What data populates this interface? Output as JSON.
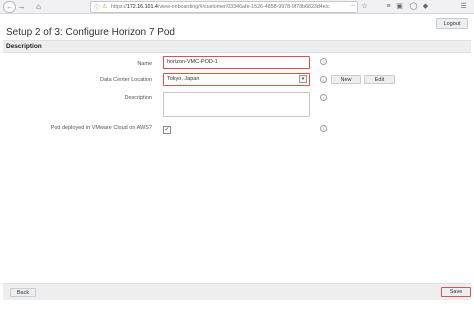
{
  "browser": {
    "url_prefix": "https://",
    "url_host": "172.16.101.4",
    "url_path": "/view-onboarding/#/customer/03346afe-1526-4858-9978-9f78b6823d4e/c",
    "url_overflow": "..."
  },
  "header": {
    "logout_label": "Logout",
    "page_title": "Setup 2 of 3: Configure Horizon 7 Pod"
  },
  "section": {
    "title": "Description"
  },
  "form": {
    "name_label": "Name",
    "name_value": "horizon-VMC-POD-1",
    "datacenter_label": "Data Center Location",
    "datacenter_value": "Tokyo, Japan",
    "new_label": "New",
    "edit_label": "Edit",
    "description_label": "Description",
    "description_value": "",
    "aws_label": "Pod deployed in VMware Cloud on AWS?",
    "aws_checked": true
  },
  "footer": {
    "back_label": "Back",
    "save_label": "Save"
  },
  "colors": {
    "highlight": "#d9534f",
    "section_bg": "#eceef0"
  },
  "icons": [
    "back-arrow-icon",
    "forward-arrow-icon",
    "home-icon",
    "info-icon",
    "lock-icon",
    "more-icon",
    "bookmark-icon",
    "library-icon",
    "sidebar-icon",
    "pocket-icon",
    "extension-icon",
    "menu-icon",
    "info-circle-icon",
    "chevron-down-icon",
    "check-icon"
  ]
}
